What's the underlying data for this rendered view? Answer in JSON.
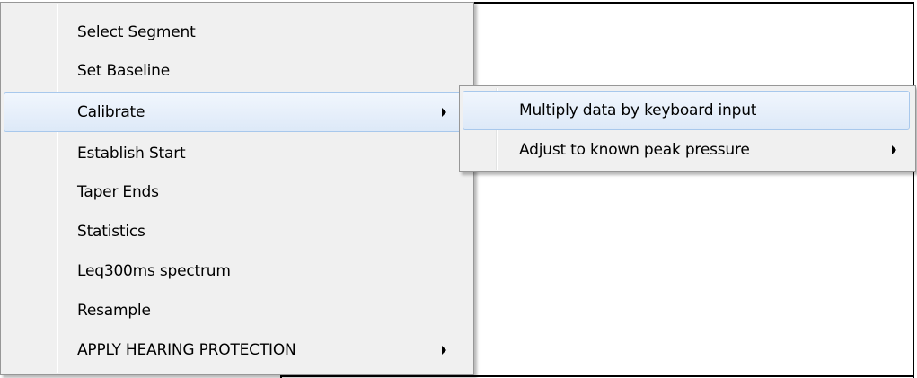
{
  "context_menu": {
    "items": [
      {
        "label": "Select Segment",
        "has_submenu": false,
        "highlighted": false
      },
      {
        "label": "Set Baseline",
        "has_submenu": false,
        "highlighted": false
      },
      {
        "label": "Calibrate",
        "has_submenu": true,
        "highlighted": true
      },
      {
        "label": "Establish Start",
        "has_submenu": false,
        "highlighted": false
      },
      {
        "label": "Taper Ends",
        "has_submenu": false,
        "highlighted": false
      },
      {
        "label": "Statistics",
        "has_submenu": false,
        "highlighted": false
      },
      {
        "label": "Leq300ms spectrum",
        "has_submenu": false,
        "highlighted": false
      },
      {
        "label": "Resample",
        "has_submenu": false,
        "highlighted": false
      },
      {
        "label": "APPLY HEARING PROTECTION",
        "has_submenu": true,
        "highlighted": false
      }
    ]
  },
  "submenu": {
    "items": [
      {
        "label": "Multiply data by keyboard input",
        "has_submenu": false,
        "highlighted": true
      },
      {
        "label": "Adjust to known peak pressure",
        "has_submenu": true,
        "highlighted": false
      }
    ]
  },
  "colors": {
    "menu_background": "#f0f0f0",
    "menu_border": "#979797",
    "highlight_top": "#f1f6fd",
    "highlight_bottom": "#dde9f8",
    "highlight_border": "#a8c8ec"
  },
  "icons": {
    "submenu_arrow": "chevron-right-icon"
  }
}
